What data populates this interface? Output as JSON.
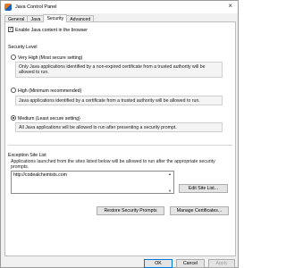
{
  "window": {
    "title": "Java Control Panel"
  },
  "tabs": [
    {
      "label": "General"
    },
    {
      "label": "Java"
    },
    {
      "label": "Security"
    },
    {
      "label": "Advanced"
    }
  ],
  "enable_java": {
    "label": "Enable Java content in the browser",
    "checked": true
  },
  "security_level": {
    "heading": "Security Level",
    "options": [
      {
        "label": "Very High (Most secure setting)",
        "description": "Only Java applications identified by a non-expired certificate from a trusted authority will be allowed to run.",
        "selected": false
      },
      {
        "label": "High (Minimum recommended)",
        "description": "Java applications identified by a certificate from a trusted authority will be allowed to run.",
        "selected": false
      },
      {
        "label": "Medium (Least secure setting)",
        "description": "All Java applications will be allowed to run after presenting a security prompt.",
        "selected": true
      }
    ]
  },
  "exception_site_list": {
    "heading": "Exception Site List",
    "description": "Applications launched from the sites listed below will be allowed to run after the appropriate security prompts.",
    "sites": [
      "http://codealchemists.com"
    ],
    "edit_button": "Edit Site List..."
  },
  "buttons": {
    "restore": "Restore Security Prompts",
    "manage": "Manage Certificates...",
    "ok": "OK",
    "cancel": "Cancel",
    "apply": "Apply"
  }
}
